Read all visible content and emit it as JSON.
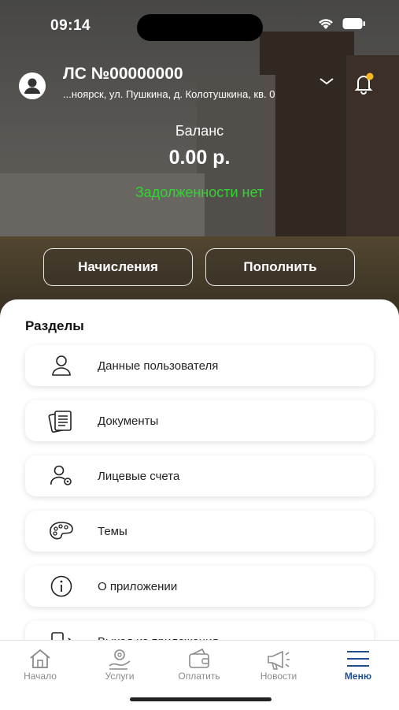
{
  "status_bar": {
    "time": "09:14"
  },
  "header": {
    "account_number": "ЛС №00000000",
    "address": "...ноярск, ул. Пушкина, д. Колотушкина, кв. 0"
  },
  "balance": {
    "label": "Баланс",
    "amount": "0.00 р.",
    "debt_status": "Задолженности нет"
  },
  "actions": {
    "charges_label": "Начисления",
    "topup_label": "Пополнить"
  },
  "sections": {
    "title": "Разделы",
    "items": [
      {
        "label": "Данные пользователя",
        "icon": "user-icon"
      },
      {
        "label": "Документы",
        "icon": "documents-icon"
      },
      {
        "label": "Лицевые счета",
        "icon": "user-settings-icon"
      },
      {
        "label": "Темы",
        "icon": "palette-icon"
      },
      {
        "label": "О приложении",
        "icon": "info-icon"
      },
      {
        "label": "Выход из приложения",
        "icon": "logout-icon"
      }
    ]
  },
  "tabbar": {
    "items": [
      {
        "label": "Начало",
        "icon": "home-icon"
      },
      {
        "label": "Услуги",
        "icon": "services-icon"
      },
      {
        "label": "Оплатить",
        "icon": "wallet-icon"
      },
      {
        "label": "Новости",
        "icon": "megaphone-icon"
      },
      {
        "label": "Меню",
        "icon": "menu-icon"
      }
    ],
    "active": "Меню"
  },
  "colors": {
    "debt_ok": "#2fd72f",
    "active_tab": "#1f4f93",
    "notification_dot": "#f5b820"
  }
}
